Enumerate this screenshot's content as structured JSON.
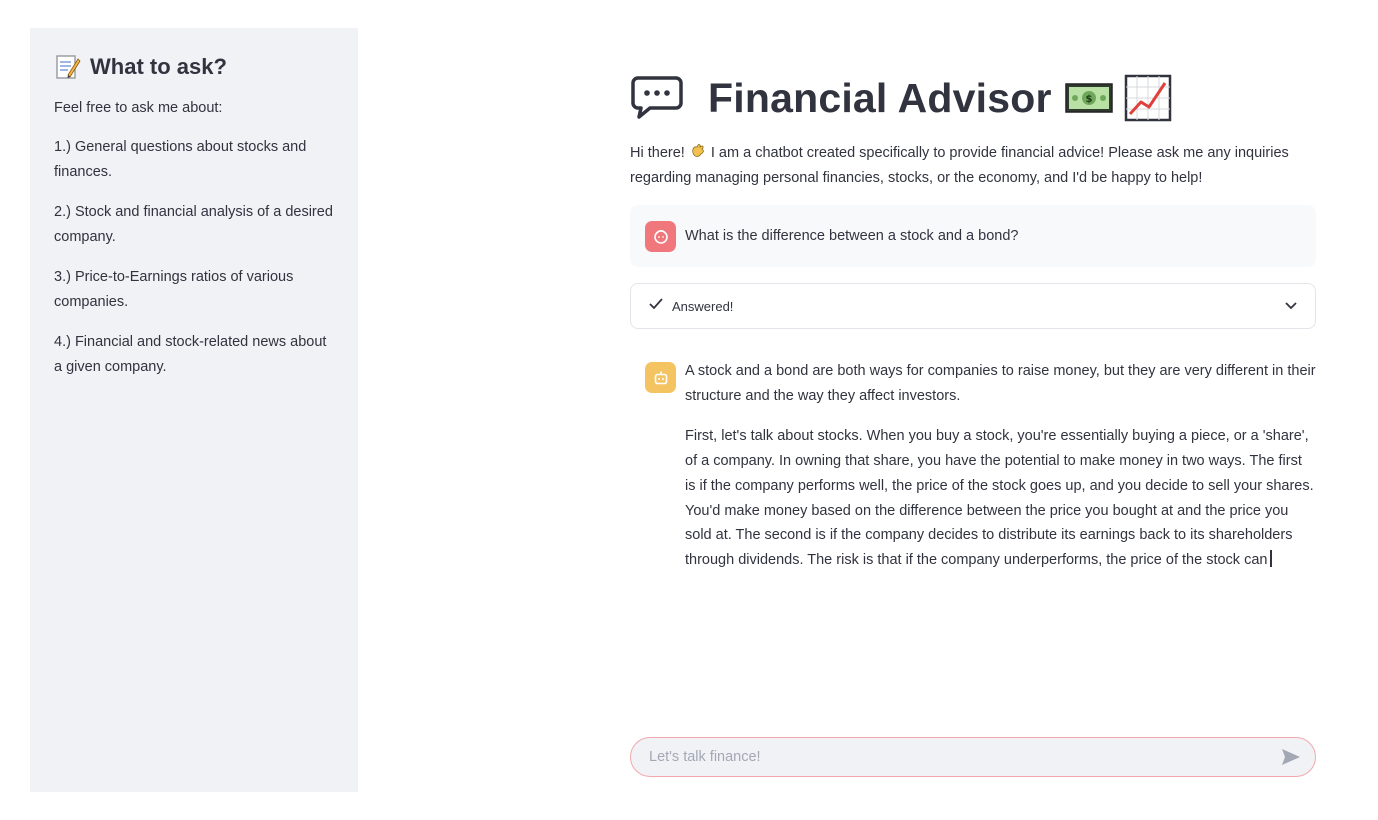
{
  "sidebar": {
    "title": "What to ask?",
    "title_icon": "memo-icon",
    "intro": "Feel free to ask me about:",
    "items": [
      "1.) General questions about stocks and finances.",
      "2.) Stock and financial analysis of a desired company.",
      "3.) Price-to-Earnings ratios of various companies.",
      "4.) Financial and stock-related news about a given company."
    ]
  },
  "header": {
    "title": "Financial Advisor",
    "icons": [
      "speech-bubble-icon",
      "dollar-bill-icon",
      "chart-increasing-icon"
    ]
  },
  "intro": {
    "line1": "Hi there! ",
    "wave_icon": "waving-hand-icon",
    "line2": " I am a chatbot created specifically to provide financial advice! Please ask me any inquiries regarding managing personal financies, stocks, or the economy, and I'd be happy to help!"
  },
  "messages": {
    "user": "What is the difference between a stock and a bond?",
    "status": "Answered!",
    "assistant": [
      "A stock and a bond are both ways for companies to raise money, but they are very different in their structure and the way they affect investors.",
      "First, let's talk about stocks. When you buy a stock, you're essentially buying a piece, or a 'share', of a company. In owning that share, you have the potential to make money in two ways. The first is if the company performs well, the price of the stock goes up, and you decide to sell your shares. You'd make money based on the difference between the price you bought at and the price you sold at. The second is if the company decides to distribute its earnings back to its shareholders through dividends. The risk is that if the company underperforms, the price of the stock can"
    ]
  },
  "chat_input": {
    "placeholder": "Let's talk finance!"
  },
  "colors": {
    "sidebar_bg": "#f0f2f6",
    "user_avatar": "#f0787d",
    "bot_avatar": "#f5c462",
    "input_border": "#f2a8ad"
  }
}
